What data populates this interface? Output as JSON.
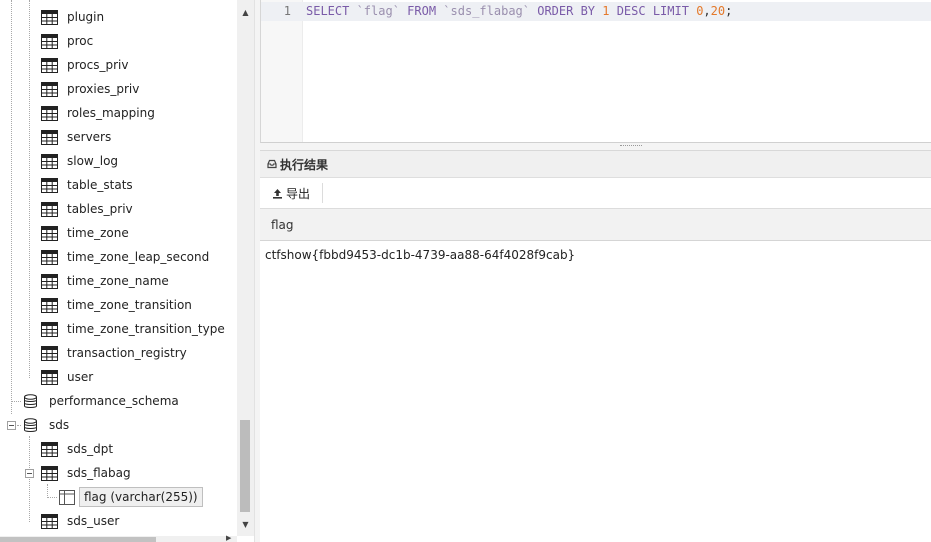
{
  "tree": {
    "items": [
      {
        "label": "plugin",
        "kind": "table"
      },
      {
        "label": "proc",
        "kind": "table"
      },
      {
        "label": "procs_priv",
        "kind": "table"
      },
      {
        "label": "proxies_priv",
        "kind": "table"
      },
      {
        "label": "roles_mapping",
        "kind": "table"
      },
      {
        "label": "servers",
        "kind": "table"
      },
      {
        "label": "slow_log",
        "kind": "table"
      },
      {
        "label": "table_stats",
        "kind": "table"
      },
      {
        "label": "tables_priv",
        "kind": "table"
      },
      {
        "label": "time_zone",
        "kind": "table"
      },
      {
        "label": "time_zone_leap_second",
        "kind": "table"
      },
      {
        "label": "time_zone_name",
        "kind": "table"
      },
      {
        "label": "time_zone_transition",
        "kind": "table"
      },
      {
        "label": "time_zone_transition_type",
        "kind": "table"
      },
      {
        "label": "transaction_registry",
        "kind": "table"
      },
      {
        "label": "user",
        "kind": "table"
      },
      {
        "label": "performance_schema",
        "kind": "database"
      },
      {
        "label": "sds",
        "kind": "database"
      },
      {
        "label": "sds_dpt",
        "kind": "table"
      },
      {
        "label": "sds_flabag",
        "kind": "table"
      },
      {
        "label": "flag (varchar(255))",
        "kind": "column",
        "selected": true
      },
      {
        "label": "sds_user",
        "kind": "table"
      }
    ]
  },
  "editor": {
    "line_number": "1",
    "tokens": [
      {
        "t": "SELECT ",
        "c": "kw"
      },
      {
        "t": "`flag`",
        "c": "ident"
      },
      {
        "t": " FROM ",
        "c": "kw"
      },
      {
        "t": "`sds_flabag`",
        "c": "ident"
      },
      {
        "t": " ORDER BY ",
        "c": "kw"
      },
      {
        "t": "1",
        "c": "num"
      },
      {
        "t": " DESC LIMIT ",
        "c": "kw"
      },
      {
        "t": "0",
        "c": "num"
      },
      {
        "t": ",",
        "c": "plain"
      },
      {
        "t": "20",
        "c": "num"
      },
      {
        "t": ";",
        "c": "plain"
      }
    ]
  },
  "results": {
    "title": "执行结果",
    "export_label": "导出",
    "column": "flag",
    "rows": [
      "ctfshow{fbbd9453-dc1b-4739-aa88-64f4028f9cab}"
    ]
  },
  "colors": {
    "keyword": "#7a5ba8",
    "identifier": "#9a8fae",
    "number": "#e4792b"
  }
}
